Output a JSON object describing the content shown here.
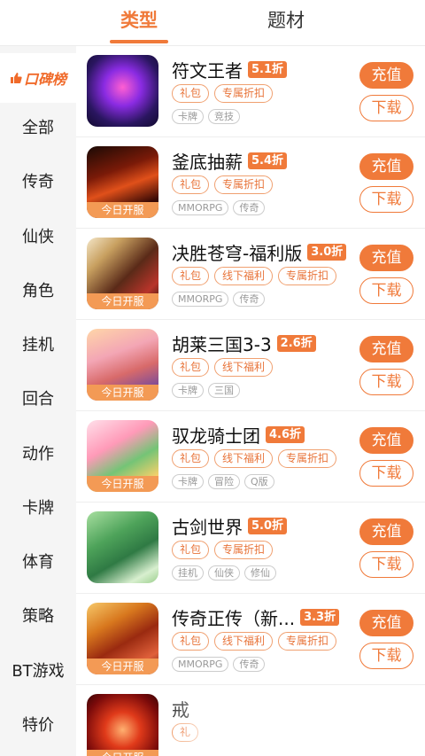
{
  "tabs": [
    {
      "label": "类型",
      "active": true
    },
    {
      "label": "题材",
      "active": false
    }
  ],
  "sidebar": {
    "top_label": "口碑榜",
    "items": [
      "全部",
      "传奇",
      "仙侠",
      "角色",
      "挂机",
      "回合",
      "动作",
      "卡牌",
      "体育",
      "策略",
      "BT游戏",
      "特价"
    ]
  },
  "games": [
    {
      "title": "符文王者",
      "discount": "5.1折",
      "perks": [
        "礼包",
        "专属折扣"
      ],
      "genres": [
        "卡牌",
        "竞技"
      ],
      "banner": "",
      "charge": "充值",
      "download": "下载"
    },
    {
      "title": "釜底抽薪",
      "discount": "5.4折",
      "perks": [
        "礼包",
        "专属折扣"
      ],
      "genres": [
        "MMORPG",
        "传奇"
      ],
      "banner": "今日开服",
      "charge": "充值",
      "download": "下载"
    },
    {
      "title": "决胜苍穹-福利版",
      "discount": "3.0折",
      "perks": [
        "礼包",
        "线下福利",
        "专属折扣"
      ],
      "genres": [
        "MMORPG",
        "传奇"
      ],
      "banner": "今日开服",
      "charge": "充值",
      "download": "下载"
    },
    {
      "title": "胡莱三国3-3",
      "discount": "2.6折",
      "perks": [
        "礼包",
        "线下福利"
      ],
      "genres": [
        "卡牌",
        "三国"
      ],
      "banner": "今日开服",
      "charge": "充值",
      "download": "下载"
    },
    {
      "title": "驭龙骑士团",
      "discount": "4.6折",
      "perks": [
        "礼包",
        "线下福利",
        "专属折扣"
      ],
      "genres": [
        "卡牌",
        "冒险",
        "Q版"
      ],
      "banner": "今日开服",
      "charge": "充值",
      "download": "下载"
    },
    {
      "title": "古剑世界",
      "discount": "5.0折",
      "perks": [
        "礼包",
        "专属折扣"
      ],
      "genres": [
        "挂机",
        "仙侠",
        "修仙"
      ],
      "banner": "",
      "charge": "充值",
      "download": "下载"
    },
    {
      "title": "传奇正传（新...",
      "discount": "3.3折",
      "perks": [
        "礼包",
        "线下福利",
        "专属折扣"
      ],
      "genres": [
        "MMORPG",
        "传奇"
      ],
      "banner": "今日开服",
      "charge": "充值",
      "download": "下载"
    },
    {
      "title": "戒",
      "discount": "",
      "perks": [
        "礼"
      ],
      "genres": [],
      "banner": "今日开服",
      "charge": "",
      "download": ""
    }
  ],
  "colors": {
    "accent": "#f07a3a",
    "sidebar_bg": "#f5f5f5",
    "banner": "#f39a55"
  }
}
